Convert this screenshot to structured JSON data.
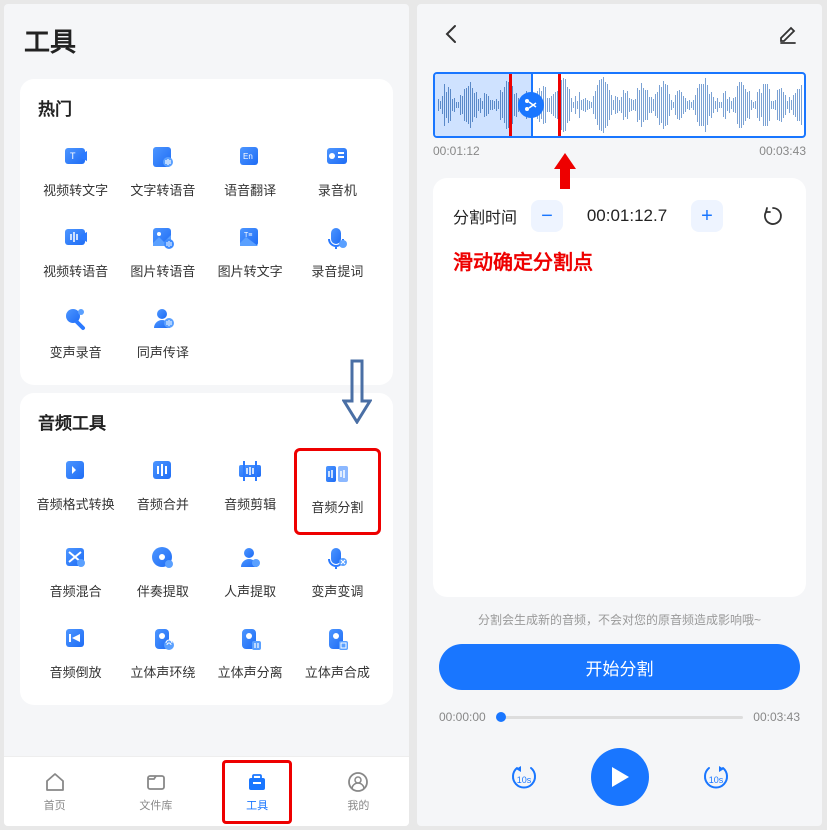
{
  "left": {
    "title": "工具",
    "sections": [
      {
        "title": "热门",
        "items": [
          {
            "label": "视频转文字",
            "icon": "video-text-icon"
          },
          {
            "label": "文字转语音",
            "icon": "text-audio-icon"
          },
          {
            "label": "语音翻译",
            "icon": "speech-translate-icon"
          },
          {
            "label": "录音机",
            "icon": "recorder-icon"
          },
          {
            "label": "视频转语音",
            "icon": "video-audio-icon"
          },
          {
            "label": "图片转语音",
            "icon": "image-audio-icon"
          },
          {
            "label": "图片转文字",
            "icon": "image-text-icon"
          },
          {
            "label": "录音提词",
            "icon": "teleprompter-icon"
          },
          {
            "label": "变声录音",
            "icon": "voice-change-icon"
          },
          {
            "label": "同声传译",
            "icon": "interpret-icon"
          }
        ]
      },
      {
        "title": "音频工具",
        "items": [
          {
            "label": "音频格式转换",
            "icon": "format-convert-icon"
          },
          {
            "label": "音频合并",
            "icon": "audio-merge-icon"
          },
          {
            "label": "音频剪辑",
            "icon": "audio-cut-icon"
          },
          {
            "label": "音频分割",
            "icon": "audio-split-icon",
            "highlight": true
          },
          {
            "label": "音频混合",
            "icon": "audio-mix-icon"
          },
          {
            "label": "伴奏提取",
            "icon": "accompaniment-icon"
          },
          {
            "label": "人声提取",
            "icon": "vocal-extract-icon"
          },
          {
            "label": "变声变调",
            "icon": "pitch-shift-icon"
          },
          {
            "label": "音频倒放",
            "icon": "reverse-icon"
          },
          {
            "label": "立体声环绕",
            "icon": "surround-icon"
          },
          {
            "label": "立体声分离",
            "icon": "stereo-split-icon"
          },
          {
            "label": "立体声合成",
            "icon": "stereo-merge-icon"
          }
        ]
      }
    ],
    "nav": [
      {
        "label": "首页",
        "icon": "home-icon"
      },
      {
        "label": "文件库",
        "icon": "files-icon"
      },
      {
        "label": "工具",
        "icon": "tools-icon",
        "active": true
      },
      {
        "label": "我的",
        "icon": "profile-icon"
      }
    ]
  },
  "right": {
    "waveform": {
      "start_time": "00:01:12",
      "end_time": "00:03:43"
    },
    "split": {
      "label": "分割时间",
      "value": "00:01:12.7",
      "hint": "滑动确定分割点"
    },
    "note": "分割会生成新的音频，不会对您的原音频造成影响哦~",
    "primary_button": "开始分割",
    "progress": {
      "current": "00:00:00",
      "total": "00:03:43"
    },
    "seek": {
      "back": "10s",
      "forward": "10s"
    }
  }
}
